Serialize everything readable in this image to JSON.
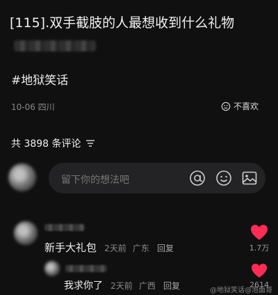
{
  "post": {
    "title": "[115].双手截肢的人最想收到什么礼物",
    "tag": "#地狱笑话",
    "meta": "10-06 四川",
    "dislike_label": "不喜欢"
  },
  "comments_header": {
    "label": "共 3898 条评论"
  },
  "composer": {
    "placeholder": "留下你的想法吧"
  },
  "comments": [
    {
      "text": "新手大礼包",
      "time": "2天前",
      "location": "广东",
      "reply": "回复",
      "likes": "1.7万"
    },
    {
      "text": "我求你了",
      "time": "2天前",
      "location": "广西",
      "reply": "回复",
      "likes": "2614"
    }
  ],
  "watermark": "@地狱笑话@泡面哥",
  "colors": {
    "background": "#101010",
    "like": "#ff2d55",
    "muted": "#8a8a8a"
  },
  "icons": [
    "dislike-icon",
    "filter-icon",
    "at-icon",
    "emoji-icon",
    "image-icon",
    "heart-icon"
  ]
}
